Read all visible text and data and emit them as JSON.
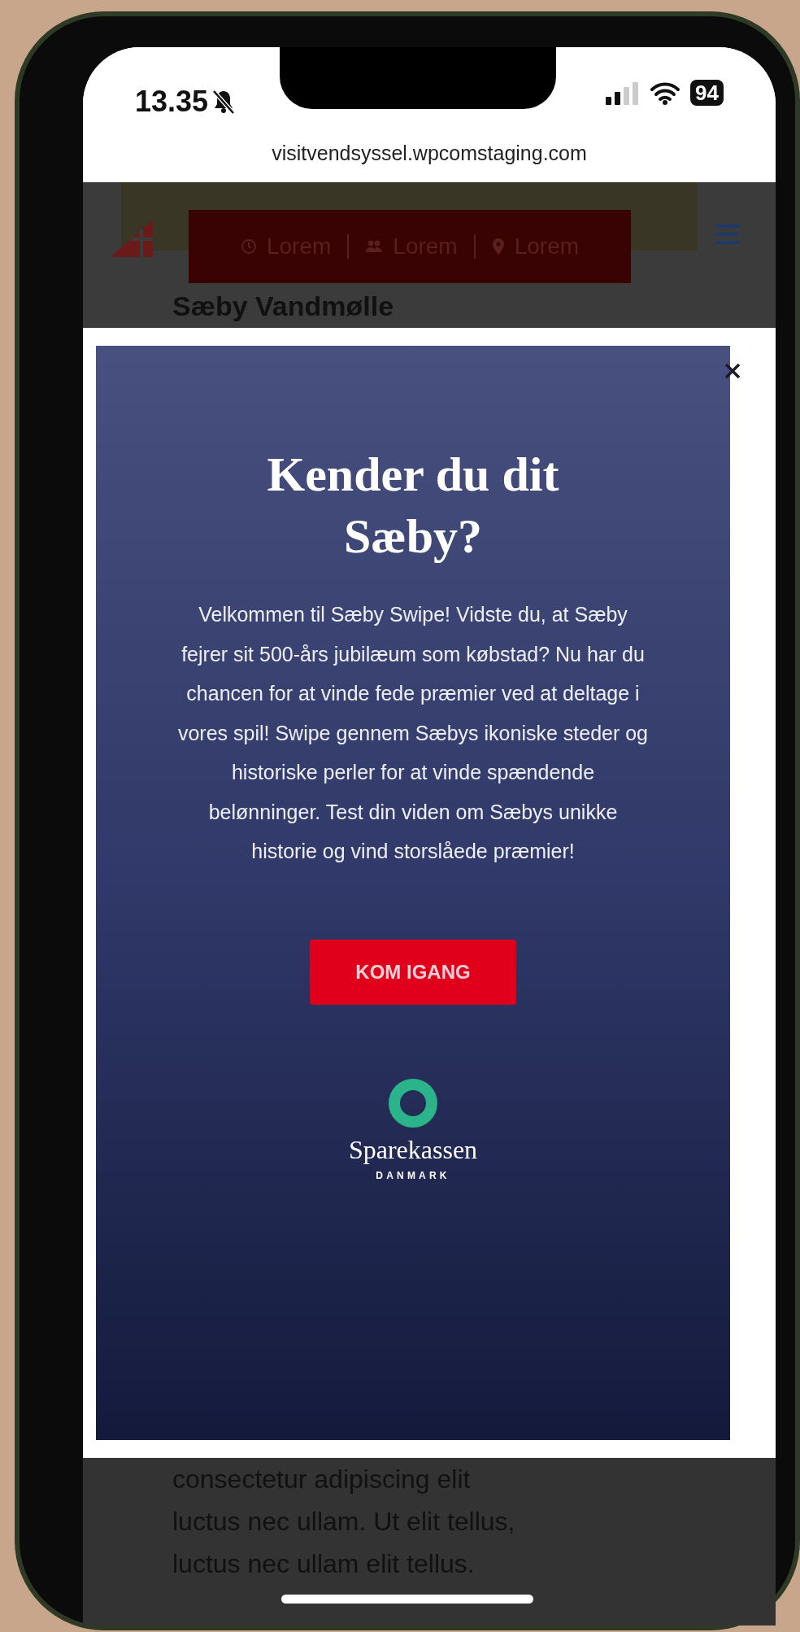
{
  "status_bar": {
    "time": "13.35",
    "muted": true,
    "battery": "94"
  },
  "address_bar": {
    "url": "visitvendsyssel.wpcomstaging.com"
  },
  "site": {
    "info_bar": [
      {
        "kind": "clock",
        "label": "Lorem"
      },
      {
        "kind": "people",
        "label": "Lorem"
      },
      {
        "kind": "pin",
        "label": "Lorem"
      }
    ],
    "title": "Sæby Vandmølle",
    "body_lines": [
      "consectetur adipiscing elit",
      "luctus nec ullam. Ut elit tellus,",
      "luctus nec ullam elit tellus."
    ]
  },
  "popup": {
    "heading": "Kender du dit Sæby?",
    "text": "Velkommen til Sæby Swipe! Vidste du, at Sæby fejrer sit 500-års jubilæum som købstad? Nu har du chancen for at vinde fede præmier ved at deltage i vores spil! Swipe gennem Sæbys ikoniske steder og historiske perler for at vinde spændende belønninger. Test din viden om Sæbys unikke historie og vind storslåede præmier!",
    "button": "KOM IGANG",
    "logo_name": "Sparekassen",
    "logo_sub": "DANMARK"
  }
}
